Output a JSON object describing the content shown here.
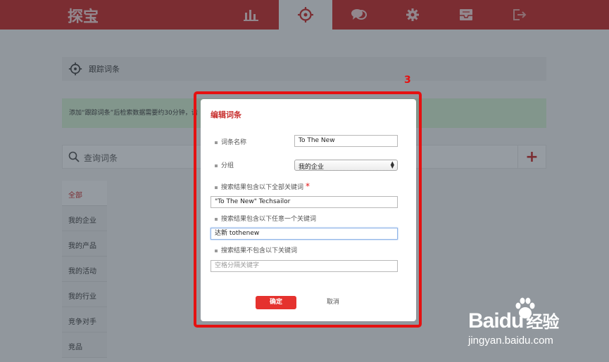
{
  "app": {
    "logo": "探宝"
  },
  "nav": [
    {
      "icon": "bar-chart-icon",
      "active": false
    },
    {
      "icon": "crosshair-icon",
      "active": true
    },
    {
      "icon": "chat-bubbles-icon",
      "active": false
    },
    {
      "icon": "gear-icon",
      "active": false
    },
    {
      "icon": "inbox-icon",
      "active": false
    },
    {
      "icon": "logout-icon",
      "active": false
    }
  ],
  "page": {
    "title": "跟踪词条",
    "notice": "添加“跟踪词条”后检索数据需要约30分钟，请",
    "search_label": "查询词条",
    "add_symbol": "+"
  },
  "sidebar": {
    "items": [
      {
        "label": "全部",
        "active": true
      },
      {
        "label": "我的企业",
        "active": false
      },
      {
        "label": "我的产品",
        "active": false
      },
      {
        "label": "我的活动",
        "active": false
      },
      {
        "label": "我的行业",
        "active": false
      },
      {
        "label": "竞争对手",
        "active": false
      },
      {
        "label": "竞品",
        "active": false
      }
    ]
  },
  "annotation": {
    "step": "3"
  },
  "modal": {
    "title": "编辑词条",
    "name_label": "词条名称",
    "name_value": "To The New",
    "group_label": "分组",
    "group_selected": "我的企业",
    "all_keywords_label": "搜索结果包含以下全部关键词",
    "required_mark": "*",
    "all_keywords_value": "\"To The New\" Techsailor",
    "any_keywords_label": "搜索结果包含以下任意一个关键词",
    "any_keywords_value": "达新 tothenew",
    "exclude_keywords_label": "搜索结果不包含以下关键词",
    "exclude_placeholder": "空格分隔关键字",
    "confirm_label": "确定",
    "cancel_label": "取消"
  },
  "watermark": {
    "brand": "Baidu",
    "suffix": "经验",
    "url": "jingyan.baidu.com"
  },
  "colors": {
    "brand_red": "#c8312f",
    "confirm_red": "#e5322e",
    "annotation_red": "#e51111",
    "notice_green": "#d6efd2"
  }
}
